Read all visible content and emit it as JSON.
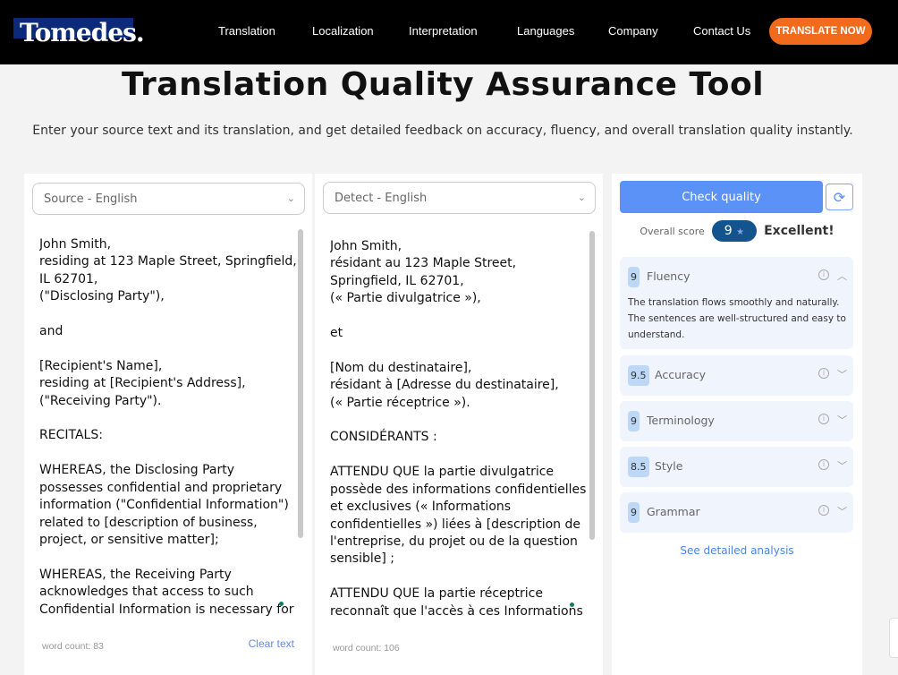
{
  "nav": {
    "logo": "Tomedes.",
    "links": [
      "Translation",
      "Localization",
      "Interpretation",
      "Languages",
      "Company",
      "Contact Us"
    ],
    "cta": "TRANSLATE NOW"
  },
  "page": {
    "title": "Translation Quality Assurance Tool",
    "subtitle": "Enter your source text and its translation, and get detailed feedback on accuracy, fluency, and overall translation quality instantly."
  },
  "source": {
    "language": "Source - English",
    "text": "John Smith,\nresiding at 123 Maple Street, Springfield, IL 62701,\n(\"Disclosing Party\"),\n\nand\n\n[Recipient's Name],\nresiding at [Recipient's Address],\n(\"Receiving Party\").\n\nRECITALS:\n\nWHEREAS, the Disclosing Party possesses confidential and proprietary information (\"Confidential Information\") related to [description of business, project, or sensitive matter];\n\nWHEREAS, the Receiving Party acknowledges that access to such Confidential Information is necessary for [describe purpose, e.g.,",
    "word_count": "word count: 83",
    "clear": "Clear text"
  },
  "target": {
    "language": "Detect - English",
    "text": "John Smith,\nrésidant au 123 Maple Street, Springfield, IL 62701,\n(« Partie divulgatrice »),\n\net\n\n[Nom du destinataire],\nrésidant à [Adresse du destinataire],\n(« Partie réceptrice »).\n\nCONSIDÉRANTS :\n\nATTENDU QUE la partie divulgatrice possède des informations confidentielles et exclusives (« Informations confidentielles ») liées à [description de l'entreprise, du projet ou de la question sensible] ;\n\nATTENDU QUE la partie réceptrice reconnaît que l'accès à ces Informations confidentielles est nécessaire pour [décrire",
    "word_count": "word count: 106"
  },
  "results": {
    "check": "Check quality",
    "overall_label": "Overall score",
    "overall": "9",
    "star": "★",
    "rating": "Excellent!",
    "metrics": [
      {
        "score": "9",
        "name": "Fluency",
        "expanded": true,
        "desc": "The translation flows smoothly and naturally. The sentences are well-structured and easy to understand."
      },
      {
        "score": "9.5",
        "name": "Accuracy"
      },
      {
        "score": "9",
        "name": "Terminology"
      },
      {
        "score": "8.5",
        "name": "Style"
      },
      {
        "score": "9",
        "name": "Grammar"
      }
    ],
    "detail": "See detailed analysis"
  },
  "colors": {
    "accent": "#5b92f7",
    "cta": "#f26b1d",
    "score_pill": "#14548e"
  }
}
